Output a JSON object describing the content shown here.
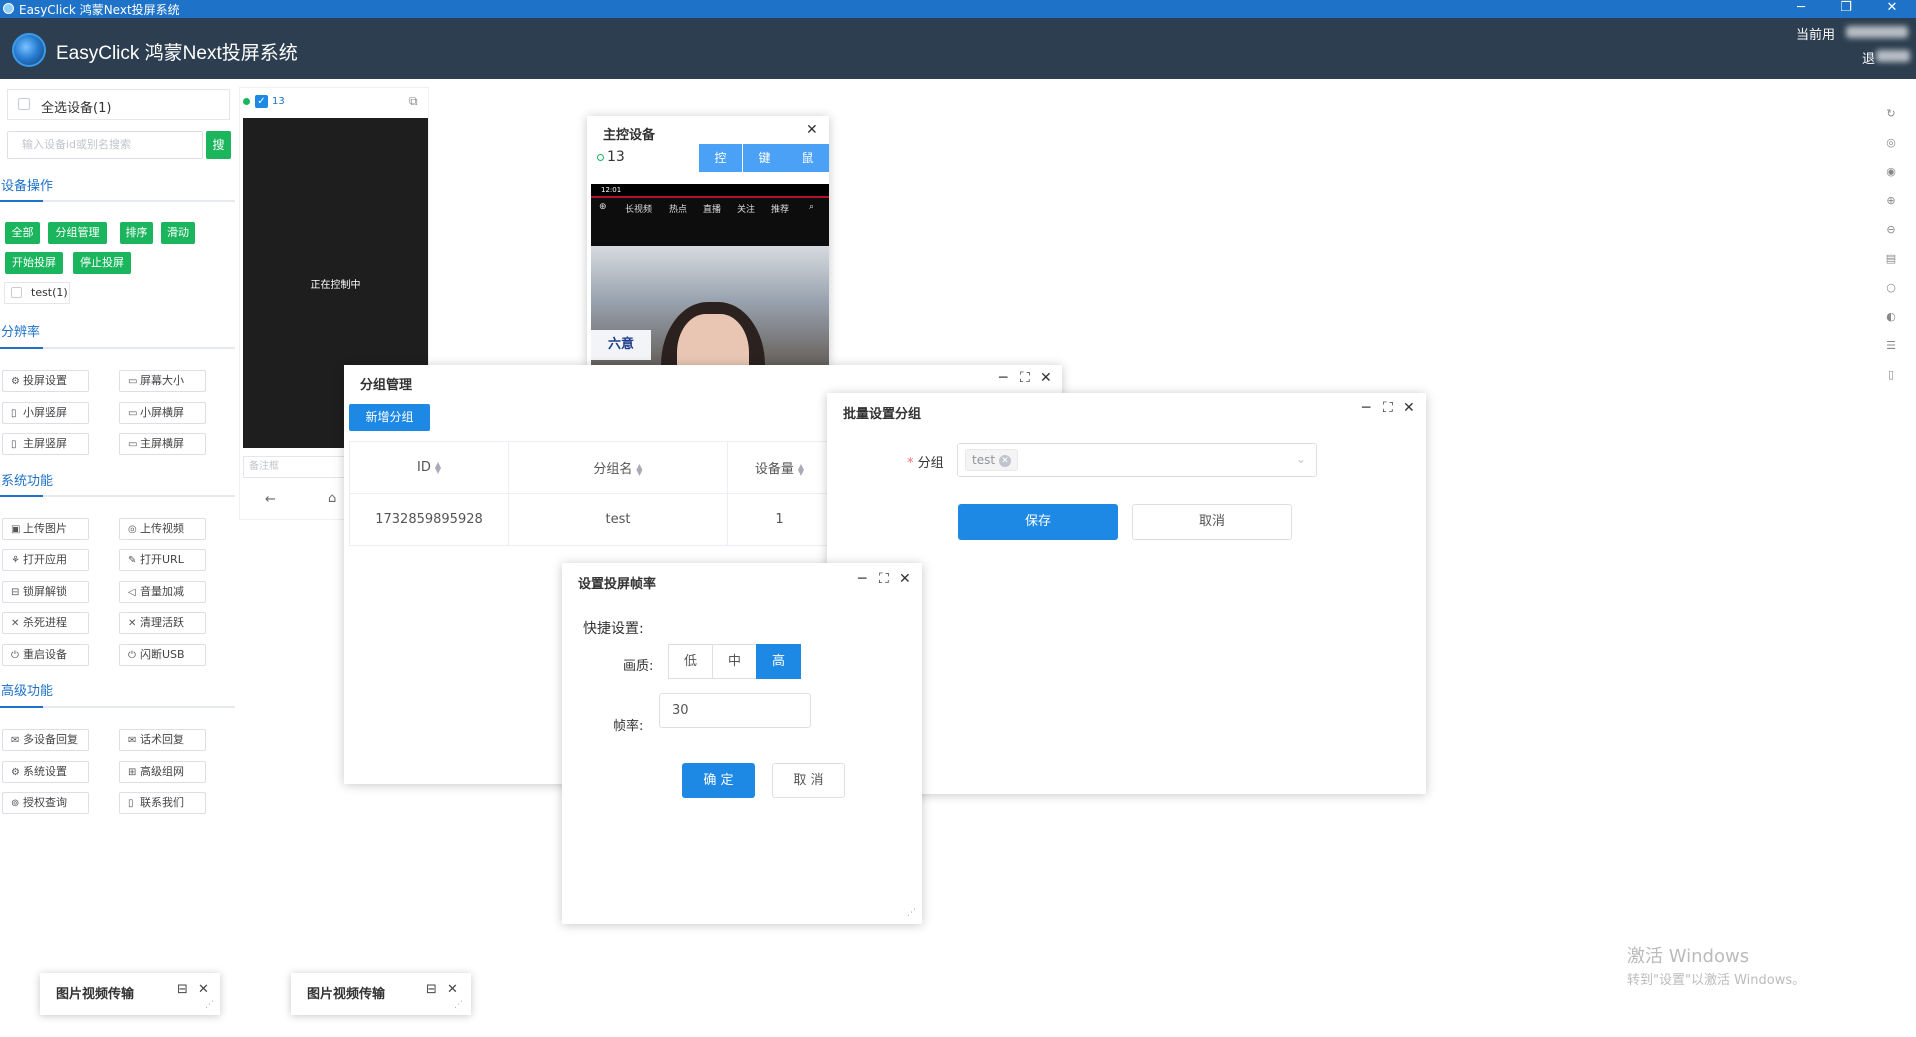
{
  "window": {
    "title": "EasyClick 鸿蒙Next投屏系统",
    "minimize": "─",
    "restore": "❐",
    "close": "✕"
  },
  "header": {
    "app_name": "EasyClick 鸿蒙Next投屏系统",
    "user_label": "当前用",
    "logout": "退"
  },
  "sidebar": {
    "select_all": "全选设备(1)",
    "search_placeholder": "输入设备id或别名搜索",
    "search_btn": "搜",
    "section_device_ops": "设备操作",
    "device_ops": [
      "全部",
      "分组管理",
      "排序",
      "滑动",
      "开始投屏",
      "停止投屏"
    ],
    "group_item": "test(1)",
    "section_resolution": "分辨率",
    "resolution": [
      "投屏设置",
      "屏幕大小",
      "小屏竖屏",
      "小屏横屏",
      "主屏竖屏",
      "主屏横屏"
    ],
    "section_system": "系统功能",
    "system": [
      "上传图片",
      "上传视频",
      "打开应用",
      "打开URL",
      "锁屏解锁",
      "音量加减",
      "杀死进程",
      "清理活跃",
      "重启设备",
      "闪断USB"
    ],
    "section_advanced": "高级功能",
    "advanced": [
      "多设备回复",
      "话术回复",
      "系统设置",
      "高级组网",
      "授权查询",
      "联系我们"
    ]
  },
  "device_card": {
    "device_id": "13",
    "screen_text": "正在控制中",
    "note_placeholder": "备注框"
  },
  "master": {
    "title": "主控设备",
    "device_id": "13",
    "tabs": [
      "控",
      "键",
      "鼠"
    ],
    "phone_time": "12:01",
    "phone_nav": [
      "长视频",
      "热点",
      "直播",
      "关注",
      "推荐"
    ],
    "phone_sign": "六意"
  },
  "group_mgmt": {
    "title": "分组管理",
    "add_btn": "新增分组",
    "columns": [
      "ID",
      "分组名",
      "设备量"
    ],
    "rows": [
      [
        "1732859895928",
        "test",
        "1"
      ]
    ]
  },
  "batch": {
    "title": "批量设置分组",
    "field_label": "分组",
    "tag": "test",
    "save": "保存",
    "cancel": "取消"
  },
  "frame_rate": {
    "title": "设置投屏帧率",
    "quick": "快捷设置:",
    "quality_label": "画质:",
    "quality_options": [
      "低",
      "中",
      "高"
    ],
    "quality_selected": 2,
    "fps_label": "帧率:",
    "fps_value": "30",
    "ok": "确 定",
    "cancel": "取 消"
  },
  "mini_windows": [
    "图片视频传输",
    "图片视频传输"
  ],
  "watermark": {
    "line1": "激活 Windows",
    "line2": "转到\"设置\"以激活 Windows。"
  },
  "colors": {
    "primary": "#1e88e5",
    "green": "#1ab55c",
    "header": "#2c3e50",
    "titlebar": "#1e72c8"
  }
}
